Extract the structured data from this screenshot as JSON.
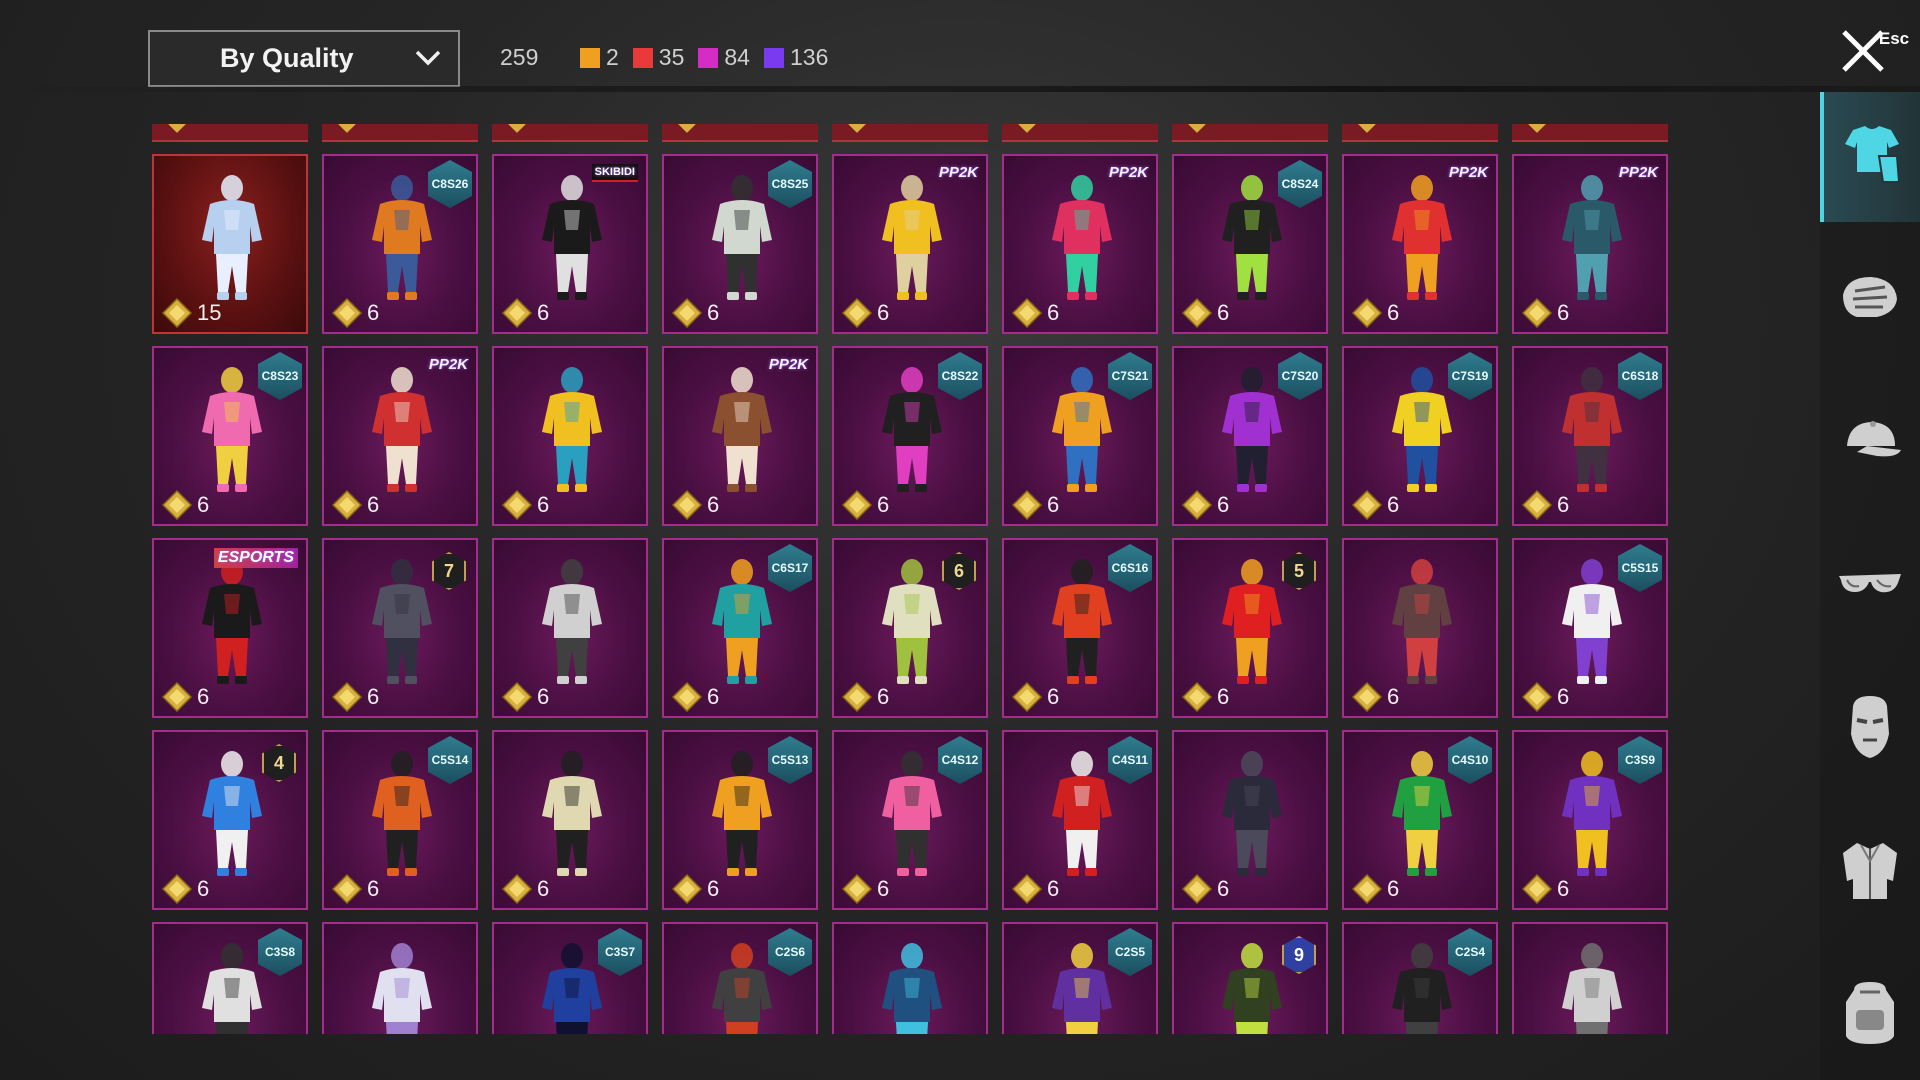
{
  "header": {
    "sort_label": "By Quality",
    "total_count": "259",
    "quality_counts": [
      {
        "color": "#f0a020",
        "count": "2"
      },
      {
        "color": "#e83a3a",
        "count": "35"
      },
      {
        "color": "#d42cc4",
        "count": "84"
      },
      {
        "color": "#7a3af0",
        "count": "136"
      }
    ],
    "close_key_label": "Esc"
  },
  "sidebar": {
    "items": [
      {
        "icon": "outfit-icon",
        "active": true
      },
      {
        "icon": "mask-icon",
        "active": false
      },
      {
        "icon": "cap-icon",
        "active": false
      },
      {
        "icon": "glasses-icon",
        "active": false
      },
      {
        "icon": "face-mask-icon",
        "active": false
      },
      {
        "icon": "jacket-icon",
        "active": false
      },
      {
        "icon": "backpack-icon",
        "active": false
      }
    ]
  },
  "grid": {
    "rows": [
      [
        {
          "count": "15",
          "badge": "",
          "badge_type": "none",
          "quality": "legendary",
          "colors": [
            "#b8d0f0",
            "#e8f0ff"
          ]
        },
        {
          "count": "6",
          "badge": "C8S26",
          "badge_type": "hex",
          "quality": "epic",
          "colors": [
            "#e07a20",
            "#3a5a9a"
          ]
        },
        {
          "count": "6",
          "badge": "SKIBIDI",
          "badge_type": "skibidi",
          "quality": "epic",
          "colors": [
            "#1a1a1a",
            "#e0e0e0"
          ]
        },
        {
          "count": "6",
          "badge": "C8S25",
          "badge_type": "hex",
          "quality": "epic",
          "colors": [
            "#d0d8d0",
            "#303030"
          ]
        },
        {
          "count": "6",
          "badge": "PP2K",
          "badge_type": "text",
          "quality": "epic",
          "colors": [
            "#f0c020",
            "#e0d0a0"
          ]
        },
        {
          "count": "6",
          "badge": "PP2K",
          "badge_type": "text",
          "quality": "epic",
          "colors": [
            "#e03060",
            "#30d0a0"
          ]
        },
        {
          "count": "6",
          "badge": "C8S24",
          "badge_type": "hex",
          "quality": "epic",
          "colors": [
            "#202020",
            "#a0e040"
          ]
        },
        {
          "count": "6",
          "badge": "PP2K",
          "badge_type": "text",
          "quality": "epic",
          "colors": [
            "#e03030",
            "#f0a020"
          ]
        },
        {
          "count": "6",
          "badge": "PP2K",
          "badge_type": "text",
          "quality": "epic",
          "colors": [
            "#2a5a6a",
            "#50a0b0"
          ]
        }
      ],
      [
        {
          "count": "6",
          "badge": "C8S23",
          "badge_type": "hex",
          "quality": "epic",
          "colors": [
            "#f06ab0",
            "#f0d040"
          ]
        },
        {
          "count": "6",
          "badge": "PP2K",
          "badge_type": "text",
          "quality": "epic",
          "colors": [
            "#d03030",
            "#f0e0d0"
          ]
        },
        {
          "count": "6",
          "badge": "",
          "badge_type": "none",
          "quality": "epic",
          "colors": [
            "#f0c020",
            "#2aa0c0"
          ]
        },
        {
          "count": "6",
          "badge": "PP2K",
          "badge_type": "text",
          "quality": "epic",
          "colors": [
            "#8a5030",
            "#f0e0d0"
          ]
        },
        {
          "count": "6",
          "badge": "C8S22",
          "badge_type": "hex",
          "quality": "epic",
          "colors": [
            "#202020",
            "#e040c0"
          ]
        },
        {
          "count": "6",
          "badge": "C7S21",
          "badge_type": "hex",
          "quality": "epic",
          "colors": [
            "#f0a020",
            "#3070c0"
          ]
        },
        {
          "count": "6",
          "badge": "C7S20",
          "badge_type": "hex",
          "quality": "epic",
          "colors": [
            "#a030d0",
            "#202030"
          ]
        },
        {
          "count": "6",
          "badge": "C7S19",
          "badge_type": "hex",
          "quality": "epic",
          "colors": [
            "#f0d020",
            "#2050a0"
          ]
        },
        {
          "count": "6",
          "badge": "C6S18",
          "badge_type": "hex",
          "quality": "epic",
          "colors": [
            "#c03030",
            "#403040"
          ]
        }
      ],
      [
        {
          "count": "6",
          "badge": "ESPORTS",
          "badge_type": "esports",
          "quality": "epic",
          "colors": [
            "#1a1a1a",
            "#d02020"
          ]
        },
        {
          "count": "6",
          "badge": "7",
          "badge_type": "circle",
          "quality": "epic",
          "colors": [
            "#505060",
            "#303040"
          ]
        },
        {
          "count": "6",
          "badge": "",
          "badge_type": "none",
          "quality": "epic",
          "colors": [
            "#d0d0d0",
            "#404040"
          ]
        },
        {
          "count": "6",
          "badge": "C6S17",
          "badge_type": "hex",
          "quality": "epic",
          "colors": [
            "#20a0a0",
            "#f0a020"
          ]
        },
        {
          "count": "6",
          "badge": "6",
          "badge_type": "circle",
          "quality": "epic",
          "colors": [
            "#e0e0c0",
            "#a0c040"
          ]
        },
        {
          "count": "6",
          "badge": "C6S16",
          "badge_type": "hex",
          "quality": "epic",
          "colors": [
            "#e04020",
            "#202020"
          ]
        },
        {
          "count": "6",
          "badge": "5",
          "badge_type": "circle",
          "quality": "epic",
          "colors": [
            "#e02020",
            "#f0a020"
          ]
        },
        {
          "count": "6",
          "badge": "",
          "badge_type": "none",
          "quality": "epic",
          "colors": [
            "#604040",
            "#d04040"
          ]
        },
        {
          "count": "6",
          "badge": "C5S15",
          "badge_type": "hex",
          "quality": "epic",
          "colors": [
            "#f0f0f0",
            "#8040d0"
          ]
        }
      ],
      [
        {
          "count": "6",
          "badge": "4",
          "badge_type": "circle",
          "quality": "epic",
          "colors": [
            "#3080e0",
            "#f0f0f0"
          ]
        },
        {
          "count": "6",
          "badge": "C5S14",
          "badge_type": "hex",
          "quality": "epic",
          "colors": [
            "#e06020",
            "#202020"
          ]
        },
        {
          "count": "6",
          "badge": "",
          "badge_type": "none",
          "quality": "epic",
          "colors": [
            "#e0d8b0",
            "#202020"
          ]
        },
        {
          "count": "6",
          "badge": "C5S13",
          "badge_type": "hex",
          "quality": "epic",
          "colors": [
            "#f0a020",
            "#202020"
          ]
        },
        {
          "count": "6",
          "badge": "C4S12",
          "badge_type": "hex",
          "quality": "epic",
          "colors": [
            "#f060a0",
            "#303030"
          ]
        },
        {
          "count": "6",
          "badge": "C4S11",
          "badge_type": "hex",
          "quality": "epic",
          "colors": [
            "#d02020",
            "#f0f0f0"
          ]
        },
        {
          "count": "6",
          "badge": "",
          "badge_type": "none",
          "quality": "epic",
          "colors": [
            "#2a2a3a",
            "#4a4a5a"
          ]
        },
        {
          "count": "6",
          "badge": "C4S10",
          "badge_type": "hex",
          "quality": "epic",
          "colors": [
            "#20a040",
            "#f0d040"
          ]
        },
        {
          "count": "6",
          "badge": "C3S9",
          "badge_type": "hex",
          "quality": "epic",
          "colors": [
            "#7030c0",
            "#f0c020"
          ]
        }
      ],
      [
        {
          "count": "",
          "badge": "C3S8",
          "badge_type": "hex",
          "quality": "epic",
          "colors": [
            "#e0e0e0",
            "#303030"
          ]
        },
        {
          "count": "",
          "badge": "",
          "badge_type": "none",
          "quality": "epic",
          "colors": [
            "#e0e0f0",
            "#a080d0"
          ]
        },
        {
          "count": "",
          "badge": "C3S7",
          "badge_type": "hex",
          "quality": "epic",
          "colors": [
            "#2040a0",
            "#101030"
          ]
        },
        {
          "count": "",
          "badge": "C2S6",
          "badge_type": "hex",
          "quality": "epic",
          "colors": [
            "#404040",
            "#d04020"
          ]
        },
        {
          "count": "",
          "badge": "",
          "badge_type": "none",
          "quality": "epic",
          "colors": [
            "#205080",
            "#40c0e0"
          ]
        },
        {
          "count": "",
          "badge": "C2S5",
          "badge_type": "hex",
          "quality": "epic",
          "colors": [
            "#6030a0",
            "#f0d040"
          ]
        },
        {
          "count": "",
          "badge": "9",
          "badge_type": "circle-blue",
          "quality": "epic",
          "colors": [
            "#304020",
            "#c0e040"
          ]
        },
        {
          "count": "",
          "badge": "C2S4",
          "badge_type": "hex",
          "quality": "epic",
          "colors": [
            "#202020",
            "#404040"
          ]
        },
        {
          "count": "",
          "badge": "",
          "badge_type": "none",
          "quality": "epic",
          "colors": [
            "#d0d0d0",
            "#707070"
          ]
        }
      ]
    ]
  }
}
